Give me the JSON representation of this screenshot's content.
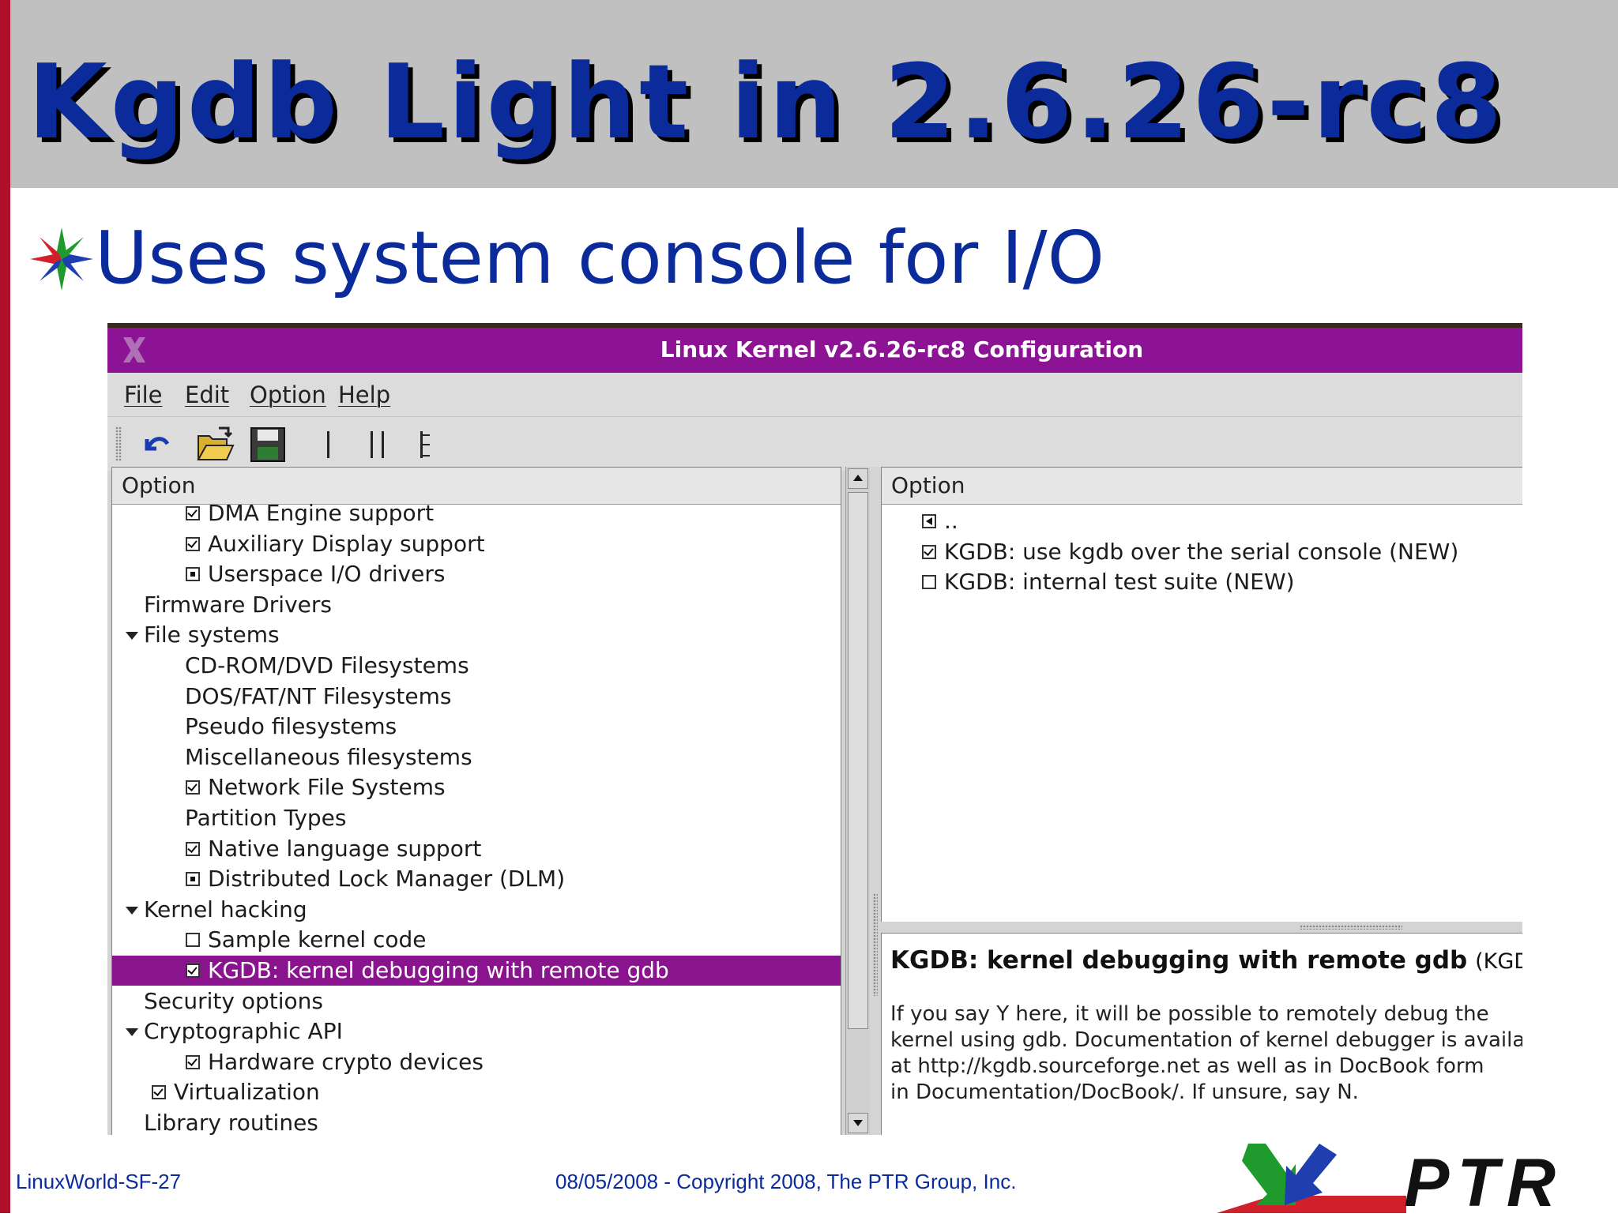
{
  "slide": {
    "title": "Kgdb Light in 2.6.26-rc8",
    "bullet": "Uses system console for I/O",
    "footer_left": "LinuxWorld-SF-27",
    "footer_center": "08/05/2008 - Copyright 2008, The PTR Group, Inc.",
    "logo_text": "PTR"
  },
  "colors": {
    "title_blue": "#0a2b99",
    "accent_red": "#b0102a",
    "window_title_purple": "#8c1494",
    "selection_purple": "#8a148e"
  },
  "window": {
    "title": "Linux Kernel v2.6.26-rc8 Configuration",
    "close_icon": "x-logo-icon",
    "menu": [
      "File",
      "Edit",
      "Option",
      "Help"
    ],
    "toolbar_icons": [
      "undo-icon",
      "open-folder-icon",
      "save-disk-icon",
      "single-view-icon",
      "split-view-icon",
      "full-view-icon"
    ]
  },
  "left_tree": {
    "header": "Option",
    "rows": [
      {
        "label": "DMA Engine support",
        "check": "checked",
        "indent": 2
      },
      {
        "label": "Auxiliary Display support",
        "check": "checked",
        "indent": 2
      },
      {
        "label": "Userspace I/O drivers",
        "check": "dot",
        "indent": 2
      },
      {
        "label": "Firmware Drivers",
        "check": "none",
        "indent": 1
      },
      {
        "label": "File systems",
        "check": "none",
        "indent": 1,
        "expander": true
      },
      {
        "label": "CD-ROM/DVD Filesystems",
        "check": "none",
        "indent": 2
      },
      {
        "label": "DOS/FAT/NT Filesystems",
        "check": "none",
        "indent": 2
      },
      {
        "label": "Pseudo filesystems",
        "check": "none",
        "indent": 2
      },
      {
        "label": "Miscellaneous filesystems",
        "check": "none",
        "indent": 2
      },
      {
        "label": "Network File Systems",
        "check": "checked",
        "indent": 2
      },
      {
        "label": "Partition Types",
        "check": "none",
        "indent": 2
      },
      {
        "label": "Native language support",
        "check": "checked",
        "indent": 2
      },
      {
        "label": "Distributed Lock Manager (DLM)",
        "check": "dot",
        "indent": 2
      },
      {
        "label": "Kernel hacking",
        "check": "none",
        "indent": 1,
        "expander": true
      },
      {
        "label": "Sample kernel code",
        "check": "unchecked",
        "indent": 2
      },
      {
        "label": "KGDB: kernel debugging with remote gdb",
        "check": "checked",
        "indent": 2,
        "selected": true
      },
      {
        "label": "Security options",
        "check": "none",
        "indent": 1
      },
      {
        "label": "Cryptographic API",
        "check": "none",
        "indent": 1,
        "expander": true
      },
      {
        "label": "Hardware crypto devices",
        "check": "checked",
        "indent": 2
      },
      {
        "label": "Virtualization",
        "check": "checked",
        "indent": 1
      },
      {
        "label": "Library routines",
        "check": "none",
        "indent": 1
      }
    ]
  },
  "right_list": {
    "header": "Option",
    "rows": [
      {
        "label": "..",
        "check": "back"
      },
      {
        "label": "KGDB: use kgdb over the serial console (NEW)",
        "check": "checked"
      },
      {
        "label": "KGDB: internal test suite (NEW)",
        "check": "unchecked"
      }
    ]
  },
  "help": {
    "title": "KGDB: kernel debugging with remote gdb",
    "symbol": "(KGDB)",
    "lines": [
      "If you say Y here, it will be possible to remotely debug the",
      "kernel using gdb. Documentation of kernel debugger is available",
      "at http://kgdb.sourceforge.net as well as in DocBook form",
      "in Documentation/DocBook/.  If unsure, say N."
    ]
  }
}
